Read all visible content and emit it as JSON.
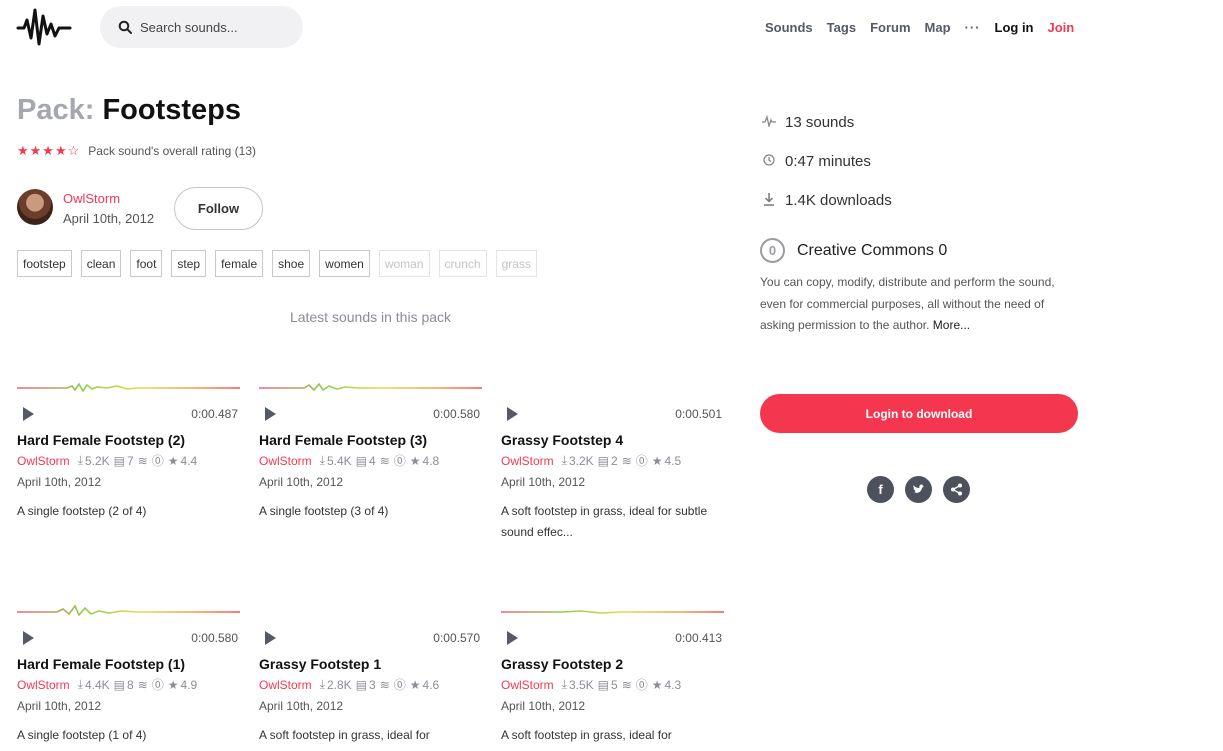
{
  "header": {
    "search_placeholder": "Search sounds...",
    "nav": [
      "Sounds",
      "Tags",
      "Forum",
      "Map"
    ],
    "more": "···",
    "login": "Log in",
    "join": "Join"
  },
  "pack": {
    "prefix": "Pack:",
    "name": "Footsteps",
    "stars": "★★★★☆",
    "rating_label": "Pack sound's overall rating (13)",
    "author": "OwlStorm",
    "date": "April 10th, 2012",
    "follow_label": "Follow",
    "tags": [
      "footstep",
      "clean",
      "foot",
      "step",
      "female",
      "shoe",
      "women"
    ],
    "tags_faded": [
      "woman",
      "crunch",
      "grass"
    ],
    "latest_label": "Latest sounds in this pack"
  },
  "sounds": [
    {
      "duration": "0:00.487",
      "name": "Hard Female Footstep (2)",
      "author": "OwlStorm",
      "downloads": "5.2K",
      "comments": "7",
      "rating": "4.4",
      "date": "April 10th, 2012",
      "desc": "A single footstep (2 of 4)"
    },
    {
      "duration": "0:00.580",
      "name": "Hard Female Footstep (3)",
      "author": "OwlStorm",
      "downloads": "5.4K",
      "comments": "4",
      "rating": "4.8",
      "date": "April 10th, 2012",
      "desc": "A single footstep (3 of 4)"
    },
    {
      "duration": "0:00.501",
      "name": "Grassy Footstep 4",
      "author": "OwlStorm",
      "downloads": "3.2K",
      "comments": "2",
      "rating": "4.5",
      "date": "April 10th, 2012",
      "desc": "A soft footstep in grass, ideal for subtle sound effec..."
    },
    {
      "duration": "0:00.580",
      "name": "Hard Female Footstep (1)",
      "author": "OwlStorm",
      "downloads": "4.4K",
      "comments": "8",
      "rating": "4.9",
      "date": "April 10th, 2012",
      "desc": "A single footstep (1 of 4)"
    },
    {
      "duration": "0:00.570",
      "name": "Grassy Footstep 1",
      "author": "OwlStorm",
      "downloads": "2.8K",
      "comments": "3",
      "rating": "4.6",
      "date": "April 10th, 2012",
      "desc": "A soft footstep in grass, ideal for"
    },
    {
      "duration": "0:00.413",
      "name": "Grassy Footstep 2",
      "author": "OwlStorm",
      "downloads": "3.5K",
      "comments": "5",
      "rating": "4.3",
      "date": "April 10th, 2012",
      "desc": "A soft footstep in grass, ideal for"
    }
  ],
  "sidebar": {
    "num_sounds": "13 sounds",
    "duration": "0:47 minutes",
    "downloads": "1.4K downloads",
    "license_title": "Creative Commons 0",
    "license_text": "You can copy, modify, distribute and perform the sound, even for commercial purposes, all without the need of asking permission to the author.",
    "license_more": "More...",
    "download_label": "Login to download"
  },
  "colors": {
    "accent": "#f33853",
    "button": "#f5364f"
  },
  "icons": [
    "logo-waveform-icon",
    "search-icon",
    "play-icon",
    "download-icon",
    "comment-icon",
    "stack-icon",
    "cc0-icon",
    "star-icon",
    "pulse-icon",
    "clock-icon",
    "facebook-icon",
    "twitter-icon",
    "share-icon"
  ]
}
